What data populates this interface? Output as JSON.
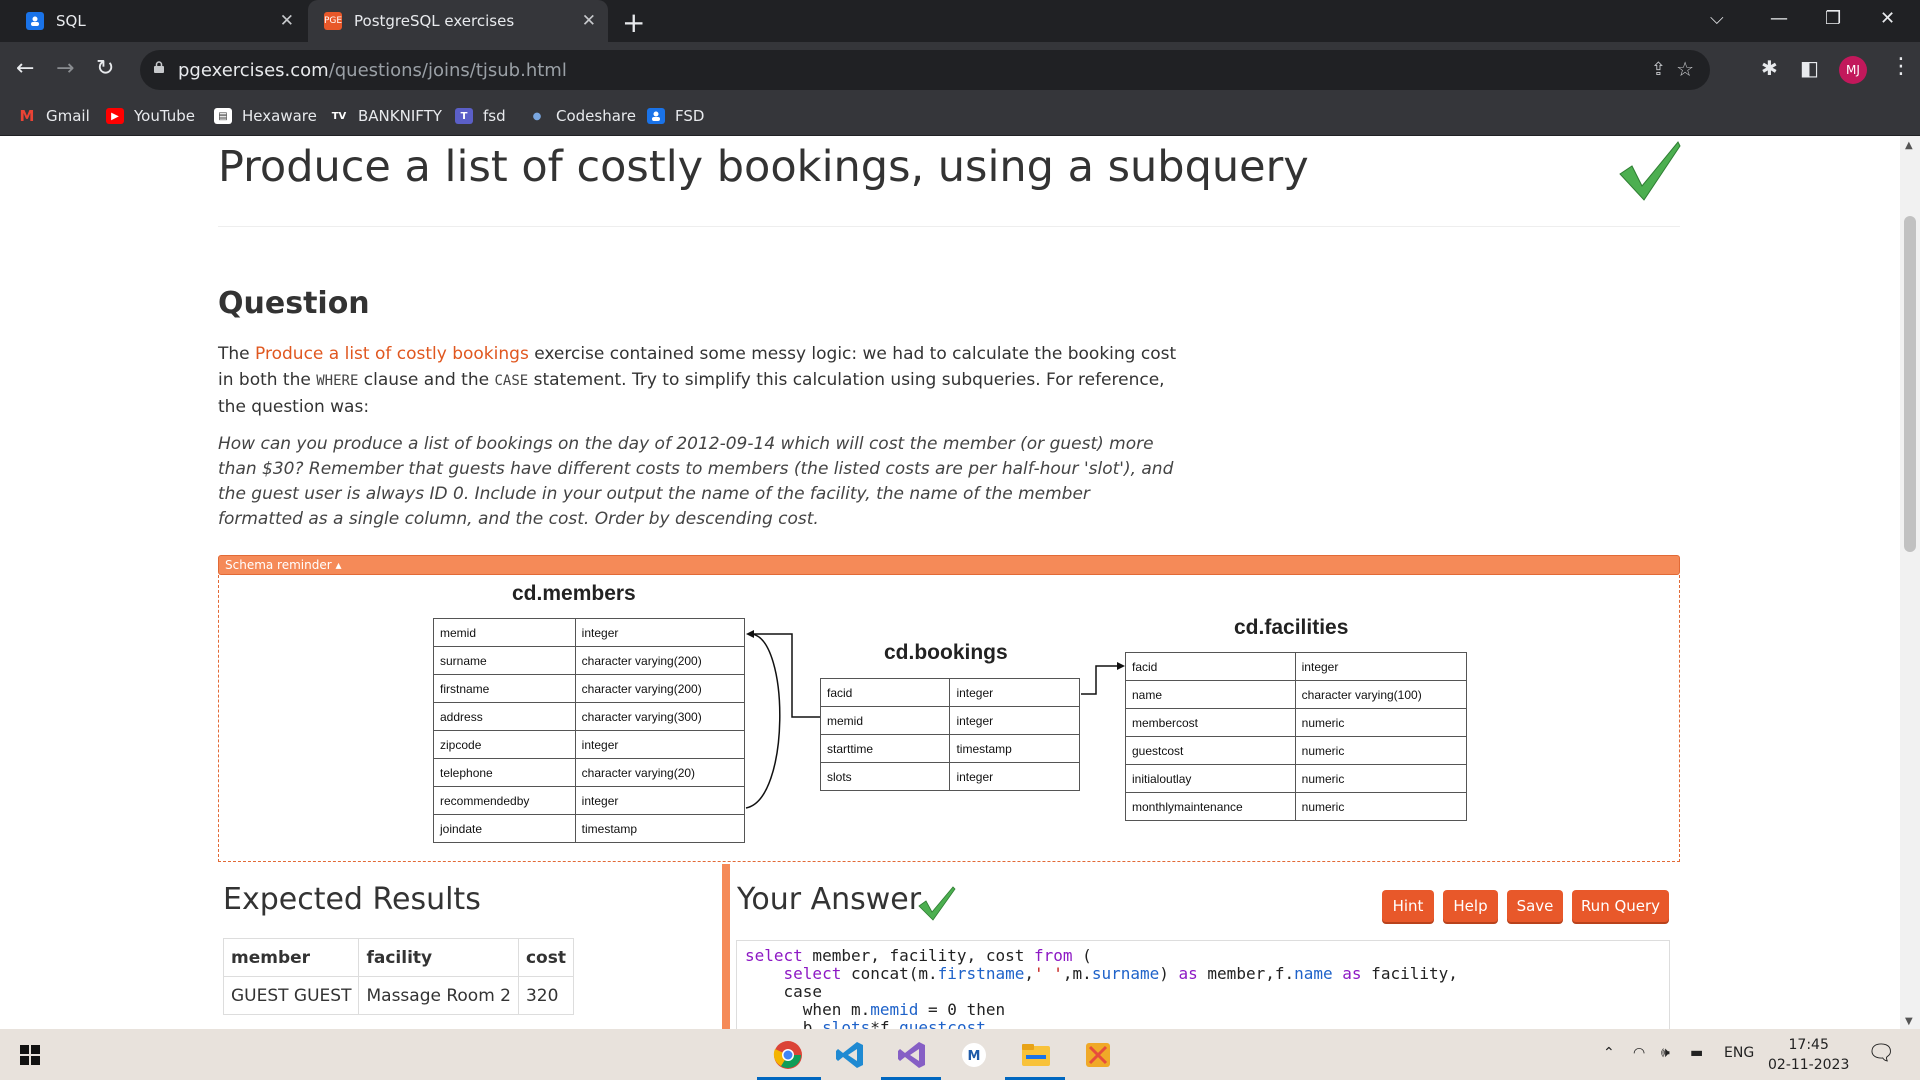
{
  "browser": {
    "tabs": [
      {
        "label": "SQL",
        "icon": "person-board-icon"
      },
      {
        "label": "PostgreSQL exercises",
        "icon": "pge-icon"
      }
    ],
    "url_host": "pgexercises.com",
    "url_path": "/questions/joins/tjsub.html",
    "profile_initials": "MJ",
    "bookmarks": [
      "Gmail",
      "YouTube",
      "Hexaware",
      "BANKNIFTY",
      "fsd",
      "Codeshare",
      "FSD"
    ]
  },
  "page": {
    "title": "Produce a list of costly bookings, using a subquery",
    "question_heading": "Question",
    "para": {
      "prefix": "The ",
      "link": "Produce a list of costly bookings",
      "mid1": " exercise contained some messy logic: we had to calculate the booking cost in both the ",
      "code1": "WHERE",
      "mid2": " clause and the ",
      "code2": "CASE",
      "suffix": " statement. Try to simplify this calculation using subqueries. For reference, the question was:"
    },
    "quote": "How can you produce a list of bookings on the day of 2012-09-14 which will cost the member (or guest) more than $30? Remember that guests have different costs to members (the listed costs are per half-hour 'slot'), and the guest user is always ID 0. Include in your output the name of the facility, the name of the member formatted as a single column, and the cost. Order by descending cost.",
    "schema_toggle": "Schema reminder ▴"
  },
  "schema": {
    "members": {
      "title": "cd.members",
      "rows": [
        [
          "memid",
          "integer"
        ],
        [
          "surname",
          "character varying(200)"
        ],
        [
          "firstname",
          "character varying(200)"
        ],
        [
          "address",
          "character varying(300)"
        ],
        [
          "zipcode",
          "integer"
        ],
        [
          "telephone",
          "character varying(20)"
        ],
        [
          "recommendedby",
          "integer"
        ],
        [
          "joindate",
          "timestamp"
        ]
      ]
    },
    "bookings": {
      "title": "cd.bookings",
      "rows": [
        [
          "facid",
          "integer"
        ],
        [
          "memid",
          "integer"
        ],
        [
          "starttime",
          "timestamp"
        ],
        [
          "slots",
          "integer"
        ]
      ]
    },
    "facilities": {
      "title": "cd.facilities",
      "rows": [
        [
          "facid",
          "integer"
        ],
        [
          "name",
          "character varying(100)"
        ],
        [
          "membercost",
          "numeric"
        ],
        [
          "guestcost",
          "numeric"
        ],
        [
          "initialoutlay",
          "numeric"
        ],
        [
          "monthlymaintenance",
          "numeric"
        ]
      ]
    }
  },
  "expected": {
    "heading": "Expected Results",
    "columns": [
      "member",
      "facility",
      "cost"
    ],
    "rows": [
      [
        "GUEST GUEST",
        "Massage Room 2",
        "320"
      ]
    ]
  },
  "answer": {
    "heading": "Your Answer",
    "buttons": {
      "hint": "Hint",
      "help": "Help",
      "save": "Save",
      "run": "Run Query"
    },
    "code_lines": [
      "select member, facility, cost from (",
      "    select concat(m.firstname,' ',m.surname) as member,f.name as facility,",
      "    case",
      "      when m.memid = 0 then",
      "      b.slots*f.guestcost"
    ]
  },
  "taskbar": {
    "lang": "ENG",
    "time": "17:45",
    "date": "02-11-2023"
  },
  "colors": {
    "accent": "#e8582a",
    "schema_bar": "#f58a58",
    "check": "#4caf50",
    "link": "#e0571f"
  }
}
